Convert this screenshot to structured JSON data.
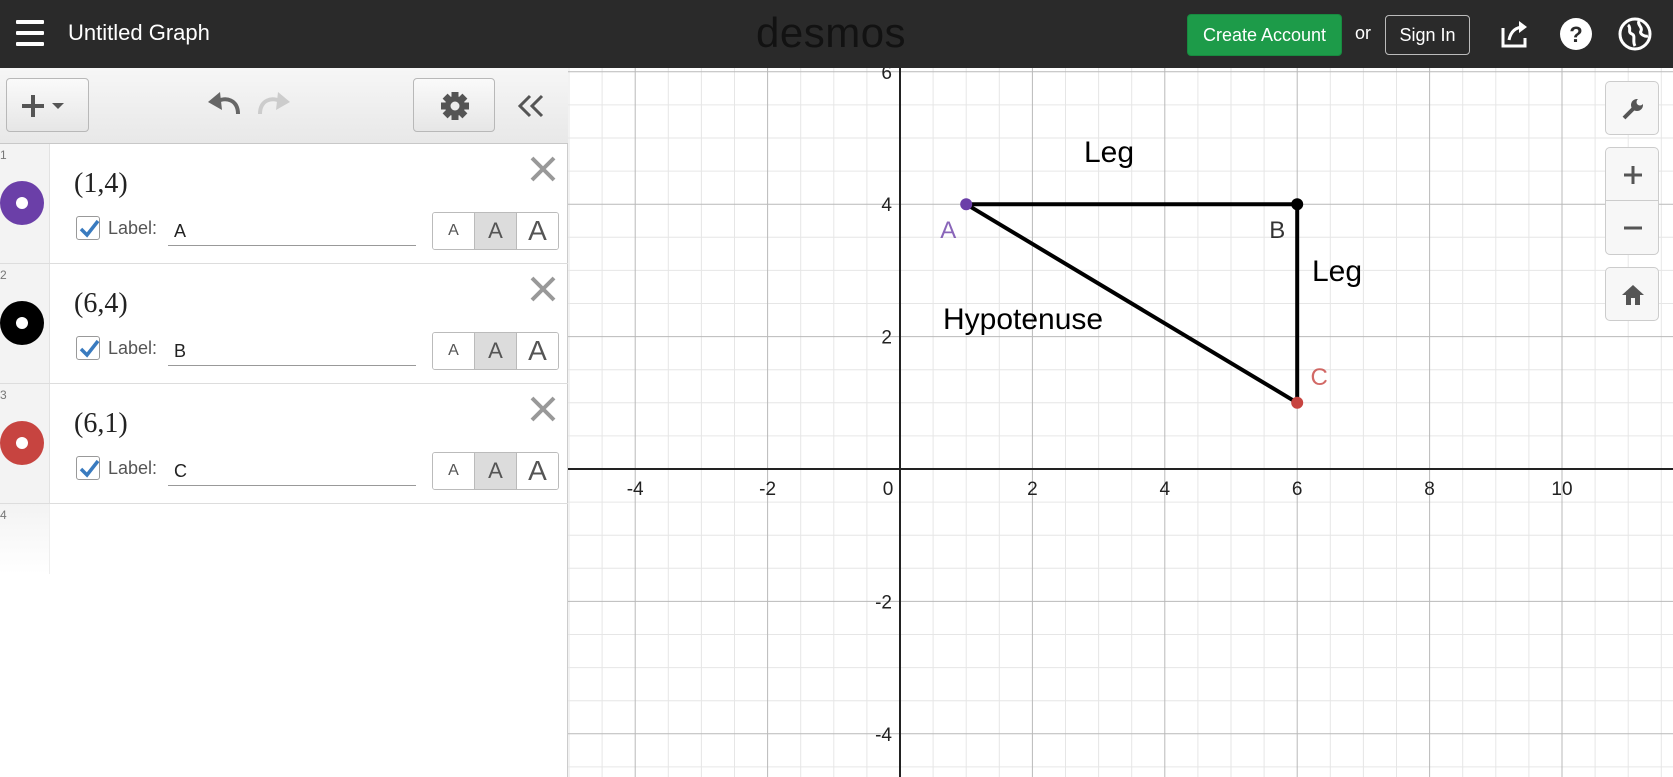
{
  "header": {
    "graph_title": "Untitled Graph",
    "logo": "desmos",
    "create_account_label": "Create Account",
    "or_text": "or",
    "sign_in_label": "Sign In",
    "icons": [
      "menu-icon",
      "share-icon",
      "help-icon",
      "globe-icon"
    ]
  },
  "toolbar": {
    "icons": [
      "add-icon",
      "undo-icon",
      "redo-icon",
      "gear-icon",
      "collapse-icon"
    ]
  },
  "expressions": [
    {
      "num": "1",
      "latex": "(1,4)",
      "color": "#6b3fa8",
      "label_text": "Label:",
      "label_value": "A",
      "size_labels": [
        "A",
        "A",
        "A"
      ]
    },
    {
      "num": "2",
      "latex": "(6,4)",
      "color": "#000000",
      "label_text": "Label:",
      "label_value": "B",
      "size_labels": [
        "A",
        "A",
        "A"
      ]
    },
    {
      "num": "3",
      "latex": "(6,1)",
      "color": "#c74440",
      "label_text": "Label:",
      "label_value": "C",
      "size_labels": [
        "A",
        "A",
        "A"
      ]
    },
    {
      "num": "4"
    }
  ],
  "graph": {
    "x_ticks": [
      "-4",
      "-2",
      "0",
      "2",
      "4",
      "6",
      "8",
      "10"
    ],
    "y_ticks": [
      "6",
      "4",
      "2",
      "-2",
      "-4"
    ],
    "points": [
      {
        "label": "A",
        "x": 1,
        "y": 4,
        "color": "#6b3fa8"
      },
      {
        "label": "B",
        "x": 6,
        "y": 4,
        "color": "#000000"
      },
      {
        "label": "C",
        "x": 6,
        "y": 1,
        "color": "#c74440"
      }
    ],
    "annotations": {
      "leg_top": "Leg",
      "leg_right": "Leg",
      "hypotenuse": "Hypotenuse"
    }
  },
  "graph_controls": {
    "icons": [
      "wrench-icon",
      "zoom-in-icon",
      "zoom-out-icon",
      "home-icon"
    ]
  }
}
